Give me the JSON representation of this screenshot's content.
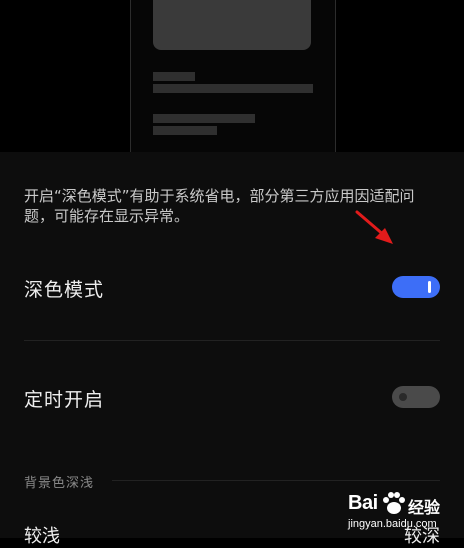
{
  "description": "开启“深色模式”有助于系统省电，部分第三方应用因适配问题，可能存在显示异常。",
  "dark_mode": {
    "label": "深色模式",
    "enabled": true
  },
  "scheduled": {
    "label": "定时开启",
    "enabled": false
  },
  "background_depth": {
    "section_label": "背景色深浅",
    "option_left": "较浅",
    "option_right": "较深"
  },
  "colors": {
    "accent": "#3d6ef7",
    "toggle_off": "#4a4a4a",
    "annotation_arrow": "#e21b1b"
  },
  "watermark": {
    "logo": "Bai",
    "logo_cn": "经验",
    "url": "jingyan.baidu.com"
  }
}
